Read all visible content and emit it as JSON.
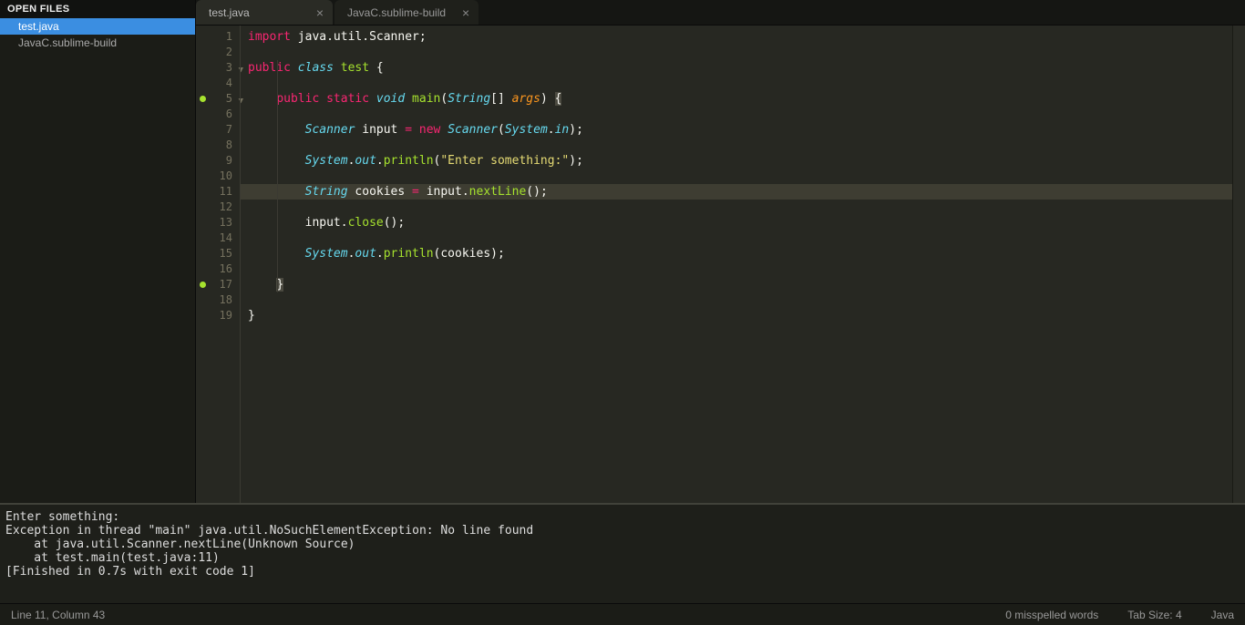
{
  "sidebar": {
    "header": "OPEN FILES",
    "items": [
      {
        "label": "test.java",
        "active": true
      },
      {
        "label": "JavaC.sublime-build",
        "active": false
      }
    ]
  },
  "tabs": [
    {
      "label": "test.java",
      "active": true
    },
    {
      "label": "JavaC.sublime-build",
      "active": false
    }
  ],
  "code": {
    "lines": [
      {
        "n": 1,
        "tokens": [
          {
            "t": "import ",
            "c": "tok-kw"
          },
          {
            "t": "java.util.Scanner",
            "c": "tok-ns"
          },
          {
            "t": ";",
            "c": "tok-plain"
          }
        ]
      },
      {
        "n": 2,
        "tokens": []
      },
      {
        "n": 3,
        "fold": true,
        "tokens": [
          {
            "t": "public ",
            "c": "tok-kw"
          },
          {
            "t": "class ",
            "c": "tok-type"
          },
          {
            "t": "test ",
            "c": "tok-fn"
          },
          {
            "t": "{",
            "c": "tok-plain"
          }
        ]
      },
      {
        "n": 4,
        "tokens": []
      },
      {
        "n": 5,
        "fold": true,
        "marker": true,
        "tokens": [
          {
            "t": "    ",
            "c": ""
          },
          {
            "t": "public ",
            "c": "tok-kw"
          },
          {
            "t": "static ",
            "c": "tok-kw"
          },
          {
            "t": "void ",
            "c": "tok-type"
          },
          {
            "t": "main",
            "c": "tok-fn"
          },
          {
            "t": "(",
            "c": "tok-plain"
          },
          {
            "t": "String",
            "c": "tok-type"
          },
          {
            "t": "[] ",
            "c": "tok-plain"
          },
          {
            "t": "args",
            "c": "tok-param"
          },
          {
            "t": ") ",
            "c": "tok-plain"
          },
          {
            "t": "{",
            "c": "tok-plain tok-bracket-hl"
          }
        ]
      },
      {
        "n": 6,
        "tokens": []
      },
      {
        "n": 7,
        "tokens": [
          {
            "t": "        ",
            "c": ""
          },
          {
            "t": "Scanner ",
            "c": "tok-type"
          },
          {
            "t": "input ",
            "c": "tok-var"
          },
          {
            "t": "= ",
            "c": "tok-op"
          },
          {
            "t": "new ",
            "c": "tok-kw"
          },
          {
            "t": "Scanner",
            "c": "tok-type"
          },
          {
            "t": "(",
            "c": "tok-plain"
          },
          {
            "t": "System",
            "c": "tok-type"
          },
          {
            "t": ".",
            "c": "tok-plain"
          },
          {
            "t": "in",
            "c": "tok-type"
          },
          {
            "t": ");",
            "c": "tok-plain"
          }
        ]
      },
      {
        "n": 8,
        "tokens": []
      },
      {
        "n": 9,
        "tokens": [
          {
            "t": "        ",
            "c": ""
          },
          {
            "t": "System",
            "c": "tok-type"
          },
          {
            "t": ".",
            "c": "tok-plain"
          },
          {
            "t": "out",
            "c": "tok-type"
          },
          {
            "t": ".",
            "c": "tok-plain"
          },
          {
            "t": "println",
            "c": "tok-fn"
          },
          {
            "t": "(",
            "c": "tok-plain"
          },
          {
            "t": "\"Enter something:\"",
            "c": "tok-str"
          },
          {
            "t": ");",
            "c": "tok-plain"
          }
        ]
      },
      {
        "n": 10,
        "tokens": []
      },
      {
        "n": 11,
        "current": true,
        "tokens": [
          {
            "t": "        ",
            "c": ""
          },
          {
            "t": "String ",
            "c": "tok-type"
          },
          {
            "t": "cookies ",
            "c": "tok-var"
          },
          {
            "t": "= ",
            "c": "tok-op"
          },
          {
            "t": "input",
            "c": "tok-var"
          },
          {
            "t": ".",
            "c": "tok-plain"
          },
          {
            "t": "nextLine",
            "c": "tok-fn"
          },
          {
            "t": "();",
            "c": "tok-plain"
          }
        ]
      },
      {
        "n": 12,
        "tokens": []
      },
      {
        "n": 13,
        "tokens": [
          {
            "t": "        ",
            "c": ""
          },
          {
            "t": "input",
            "c": "tok-var"
          },
          {
            "t": ".",
            "c": "tok-plain"
          },
          {
            "t": "close",
            "c": "tok-fn"
          },
          {
            "t": "();",
            "c": "tok-plain"
          }
        ]
      },
      {
        "n": 14,
        "tokens": []
      },
      {
        "n": 15,
        "tokens": [
          {
            "t": "        ",
            "c": ""
          },
          {
            "t": "System",
            "c": "tok-type"
          },
          {
            "t": ".",
            "c": "tok-plain"
          },
          {
            "t": "out",
            "c": "tok-type"
          },
          {
            "t": ".",
            "c": "tok-plain"
          },
          {
            "t": "println",
            "c": "tok-fn"
          },
          {
            "t": "(cookies);",
            "c": "tok-plain"
          }
        ]
      },
      {
        "n": 16,
        "tokens": []
      },
      {
        "n": 17,
        "marker": true,
        "tokens": [
          {
            "t": "    ",
            "c": ""
          },
          {
            "t": "}",
            "c": "tok-plain tok-bracket-hl"
          }
        ]
      },
      {
        "n": 18,
        "tokens": []
      },
      {
        "n": 19,
        "tokens": [
          {
            "t": "}",
            "c": "tok-plain"
          }
        ]
      }
    ]
  },
  "console": {
    "lines": [
      "Enter something:",
      "Exception in thread \"main\" java.util.NoSuchElementException: No line found",
      "    at java.util.Scanner.nextLine(Unknown Source)",
      "    at test.main(test.java:11)",
      "[Finished in 0.7s with exit code 1]"
    ]
  },
  "statusbar": {
    "position": "Line 11, Column 43",
    "spell": "0 misspelled words",
    "tabsize": "Tab Size: 4",
    "syntax": "Java"
  }
}
